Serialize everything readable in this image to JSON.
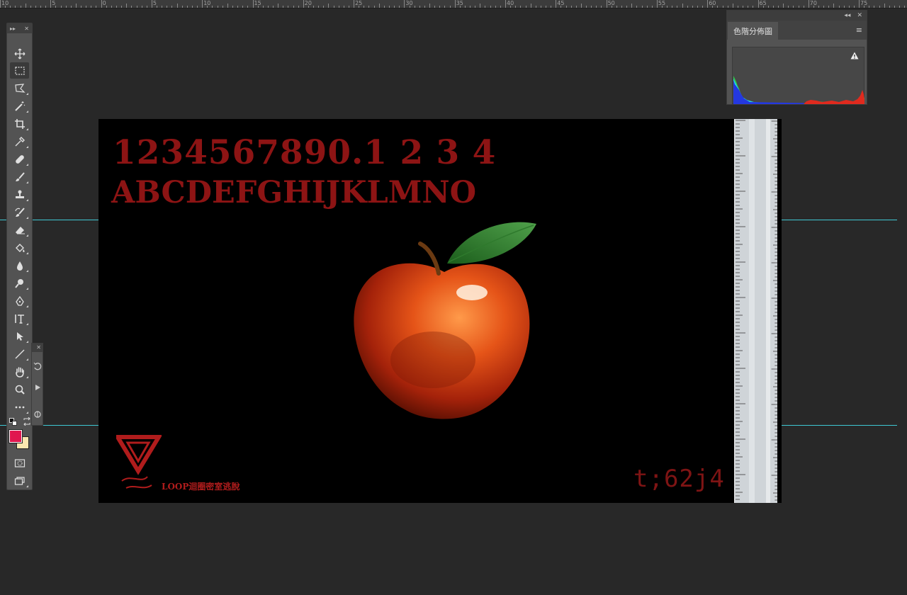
{
  "ruler": {
    "labels": [
      "10",
      "5",
      "0",
      "5",
      "10",
      "15",
      "20",
      "25",
      "30",
      "35",
      "40",
      "45",
      "50",
      "55",
      "60",
      "65",
      "70",
      "75"
    ]
  },
  "toolbar": {
    "collapse_glyph": "▸▸",
    "close_glyph": "✕",
    "tools": [
      {
        "name": "move-tool",
        "icon": "move-icon"
      },
      {
        "name": "rectangular-marquee-tool",
        "icon": "marquee-icon",
        "active": true
      },
      {
        "name": "lasso-tool",
        "icon": "lasso-icon"
      },
      {
        "name": "magic-wand-tool",
        "icon": "magic-wand-icon"
      },
      {
        "name": "crop-tool",
        "icon": "crop-icon"
      },
      {
        "name": "eyedropper-tool",
        "icon": "eyedropper-icon"
      },
      {
        "name": "healing-brush-tool",
        "icon": "bandage-icon"
      },
      {
        "name": "brush-tool",
        "icon": "brush-icon"
      },
      {
        "name": "clone-stamp-tool",
        "icon": "stamp-icon"
      },
      {
        "name": "history-brush-tool",
        "icon": "history-brush-icon"
      },
      {
        "name": "eraser-tool",
        "icon": "eraser-icon"
      },
      {
        "name": "paint-bucket-tool",
        "icon": "bucket-icon"
      },
      {
        "name": "blur-tool",
        "icon": "drop-icon"
      },
      {
        "name": "dodge-tool",
        "icon": "dodge-icon"
      },
      {
        "name": "pen-tool",
        "icon": "pen-icon"
      },
      {
        "name": "type-tool",
        "icon": "type-icon"
      },
      {
        "name": "path-selection-tool",
        "icon": "arrow-icon"
      },
      {
        "name": "line-tool",
        "icon": "line-icon"
      },
      {
        "name": "hand-tool",
        "icon": "hand-icon"
      },
      {
        "name": "zoom-tool",
        "icon": "zoom-icon"
      },
      {
        "name": "more-tools",
        "icon": "ellipsis-icon"
      }
    ],
    "foreground_color": "#e0174f",
    "background_color": "#fbe7b0"
  },
  "histogram_panel": {
    "tab_label": "色階分佈圖",
    "collapse_glyph": "◂◂",
    "close_glyph": "✕",
    "menu_glyph": "≡"
  },
  "canvas": {
    "digits_line": "1234567890.1 2 3 4",
    "letters_line": "ABCDEFGHIJKLMNO",
    "code_text": "t;62j4",
    "brand_text": "LOOP迴圈密室逃脫",
    "text_color": "#8d1414",
    "guide_color": "#3fc9d4"
  }
}
